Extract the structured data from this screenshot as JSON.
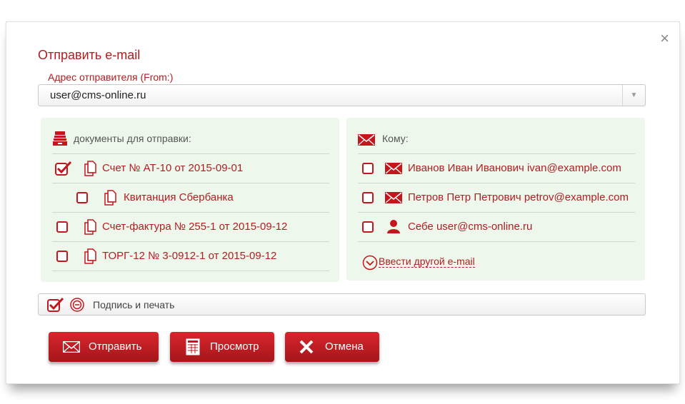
{
  "dialog": {
    "title": "Отправить e-mail",
    "close_glyph": "×",
    "from_label": "Адрес отправителя (From:)",
    "from_value": "user@cms-online.ru",
    "from_arrow": "▼"
  },
  "documents": {
    "header": "документы для отправки:",
    "items": [
      {
        "label": "Счет № АТ-10 от 2015-09-01",
        "checked": true,
        "indent": false
      },
      {
        "label": "Квитанция Сбербанка",
        "checked": false,
        "indent": true
      },
      {
        "label": "Счет-фактура № 255-1 от 2015-09-12",
        "checked": false,
        "indent": false
      },
      {
        "label": "ТОРГ-12 № 3-0912-1 от 2015-09-12",
        "checked": false,
        "indent": false
      }
    ]
  },
  "recipients": {
    "header": "Кому:",
    "items": [
      {
        "label": "Иванов Иван Иванович ivan@example.com",
        "checked": false,
        "icon": "envelope-icon"
      },
      {
        "label": "Петров Петр Петрович petrov@example.com",
        "checked": false,
        "icon": "envelope-icon"
      },
      {
        "label": "Себе user@cms-online.ru",
        "checked": false,
        "icon": "user-icon"
      }
    ],
    "add_link": "Ввести другой e-mail"
  },
  "signature": {
    "label": "Подпись и печать",
    "checked": true
  },
  "buttons": {
    "send": "Отправить",
    "preview": "Просмотр",
    "cancel": "Отмена"
  },
  "colors": {
    "accent": "#b01e22",
    "panel_bg": "#eef7ec"
  }
}
